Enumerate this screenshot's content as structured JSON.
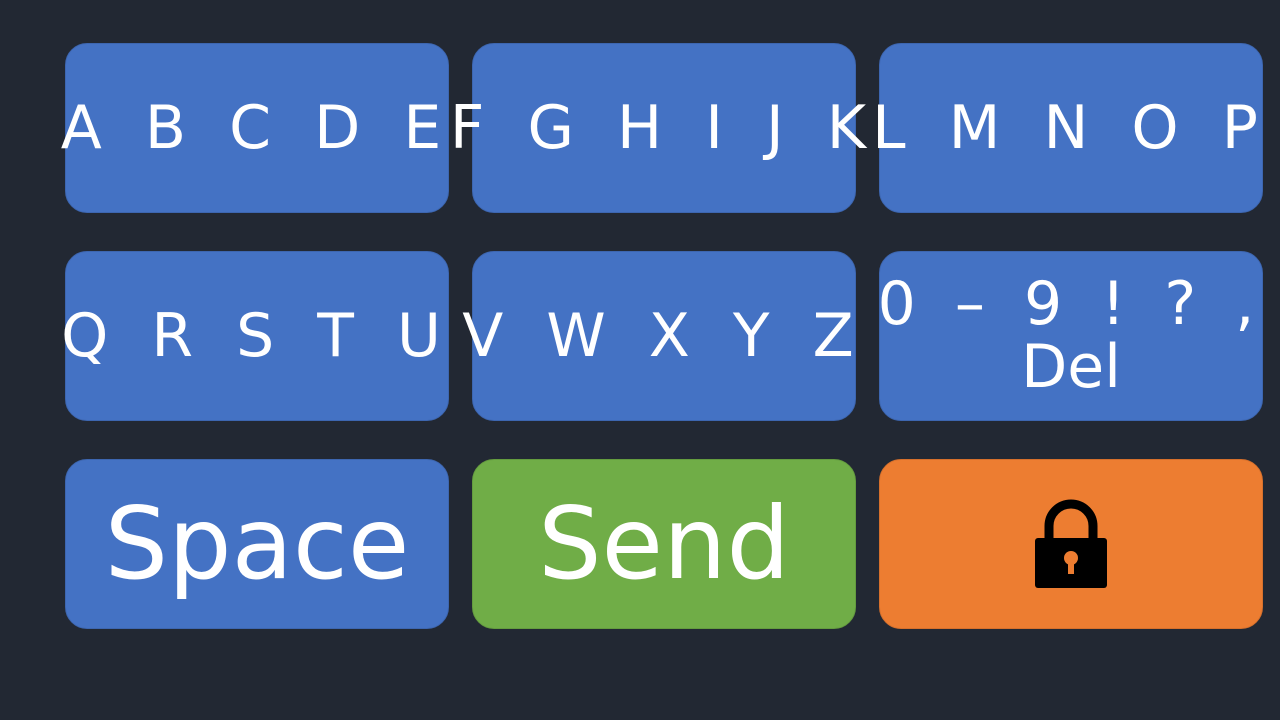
{
  "keys": {
    "group1": "A B C D E",
    "group2": "F G H I J K",
    "group3": "L M N O P",
    "group4": "Q R S T U",
    "group5": "V W X Y Z",
    "numbers_line1": "0 – 9 ! ? ,",
    "numbers_line2": "Del",
    "space": "Space",
    "send": "Send",
    "lock_icon": "lock-icon"
  },
  "colors": {
    "background": "#222833",
    "letter_key": "#4472c4",
    "send_key": "#70ad47",
    "lock_key": "#ed7d31",
    "text": "#ffffff"
  }
}
